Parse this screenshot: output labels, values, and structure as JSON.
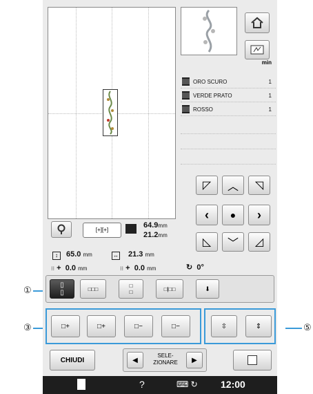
{
  "threads": [
    {
      "name": "ORO SCURO",
      "count": "1"
    },
    {
      "name": "VERDE PRATO",
      "count": "1"
    },
    {
      "name": "ROSSO",
      "count": "1"
    }
  ],
  "threads_header": "min",
  "size": {
    "height": "64.9",
    "width": "21.2",
    "unit": "mm"
  },
  "position": {
    "vertical": "65.0",
    "horizontal": "21.3",
    "unit": "mm"
  },
  "offset": {
    "v": "0.0",
    "h": "0.0",
    "unit": "mm",
    "v_sign": "+",
    "h_sign": "+",
    "angle": "0°"
  },
  "buttons": {
    "close": "CHIUDI",
    "select_line1": "SELE-",
    "select_line2": "ZIONARE"
  },
  "status": {
    "time": "12:00",
    "help": "?"
  },
  "callouts": {
    "one": "①",
    "three": "③",
    "five": "⑤"
  },
  "colors": {
    "accent": "#3a9ad9",
    "statusbar": "#1e1e1e"
  }
}
